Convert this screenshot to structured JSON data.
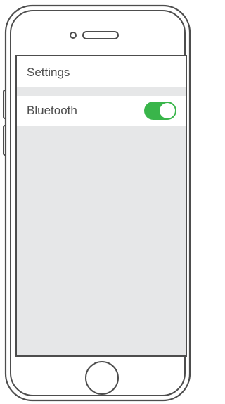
{
  "screen": {
    "title": "Settings"
  },
  "settings": {
    "rows": [
      {
        "label": "Bluetooth",
        "toggle_on": true
      }
    ]
  },
  "colors": {
    "toggle_on": "#39b54a",
    "screen_background": "#e6e7e8",
    "text": "#4d4d4d",
    "device_outline": "#4d4d4d"
  },
  "icons": {
    "camera": "front-camera-icon",
    "speaker": "earpiece-speaker-icon",
    "home": "home-button-icon"
  }
}
